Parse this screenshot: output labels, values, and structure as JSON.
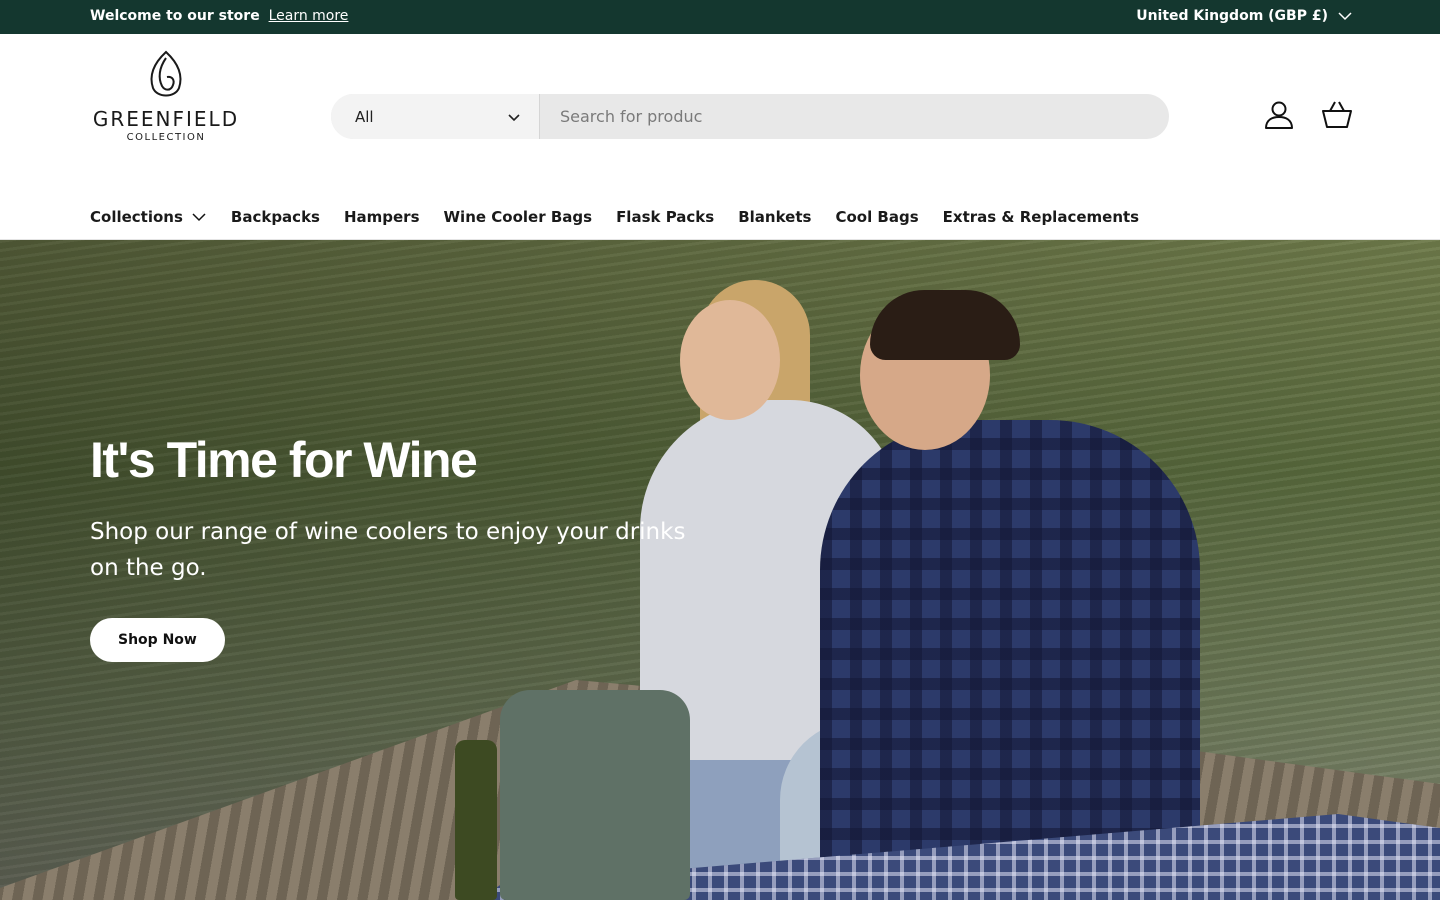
{
  "announcement": {
    "welcome": "Welcome to our store",
    "learn_more": "Learn more",
    "region": "United Kingdom (GBP £)"
  },
  "logo": {
    "brand": "GREENFIELD",
    "sub": "COLLECTION"
  },
  "search": {
    "category": "All",
    "placeholder": "Search for produc"
  },
  "icons": {
    "account": "user-icon",
    "cart": "basket-icon"
  },
  "nav": {
    "items": [
      {
        "label": "Collections"
      },
      {
        "label": "Backpacks"
      },
      {
        "label": "Hampers"
      },
      {
        "label": "Wine Cooler Bags"
      },
      {
        "label": "Flask Packs"
      },
      {
        "label": "Blankets"
      },
      {
        "label": "Cool Bags"
      },
      {
        "label": "Extras & Replacements"
      }
    ]
  },
  "hero": {
    "title": "It's Time for Wine",
    "subtitle": "Shop our range of wine coolers to enjoy your drinks on the go.",
    "cta": "Shop Now"
  },
  "colors": {
    "announcement_bg": "#14372f",
    "search_bg": "#e8e8e8"
  }
}
